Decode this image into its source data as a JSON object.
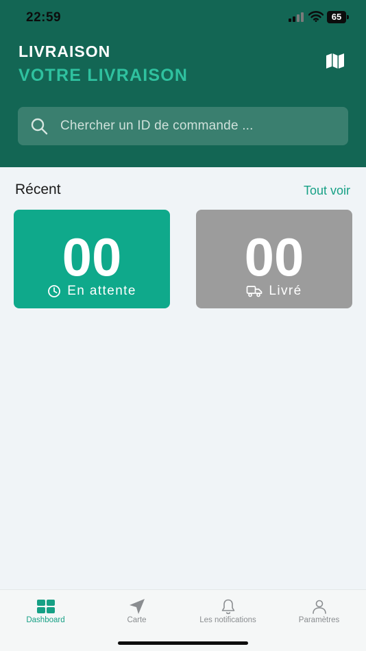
{
  "status_bar": {
    "time": "22:59",
    "battery": "65"
  },
  "header": {
    "title": "LIVRAISON",
    "subtitle": "VOTRE LIVRAISON",
    "map_icon": "map-icon"
  },
  "search": {
    "placeholder": "Chercher un ID de commande ...",
    "value": "",
    "icon": "search-icon"
  },
  "recent": {
    "title": "Récent",
    "see_all": "Tout voir",
    "cards": [
      {
        "count": "00",
        "label": "En attente",
        "icon": "clock-icon",
        "color": "#0fa98b"
      },
      {
        "count": "00",
        "label": "Livré",
        "icon": "truck-icon",
        "color": "#9c9c9c"
      }
    ]
  },
  "tabbar": {
    "active_color": "#16a085",
    "items": [
      {
        "label": "Dashboard",
        "icon": "dashboard-icon",
        "active": true
      },
      {
        "label": "Carte",
        "icon": "navigation-arrow-icon",
        "active": false
      },
      {
        "label": "Les notifications",
        "icon": "bell-icon",
        "active": false
      },
      {
        "label": "Paramètres",
        "icon": "user-icon",
        "active": false
      }
    ]
  },
  "colors": {
    "header_bg": "#136654",
    "accent": "#2fc19f",
    "page_bg": "#f0f4f7"
  }
}
